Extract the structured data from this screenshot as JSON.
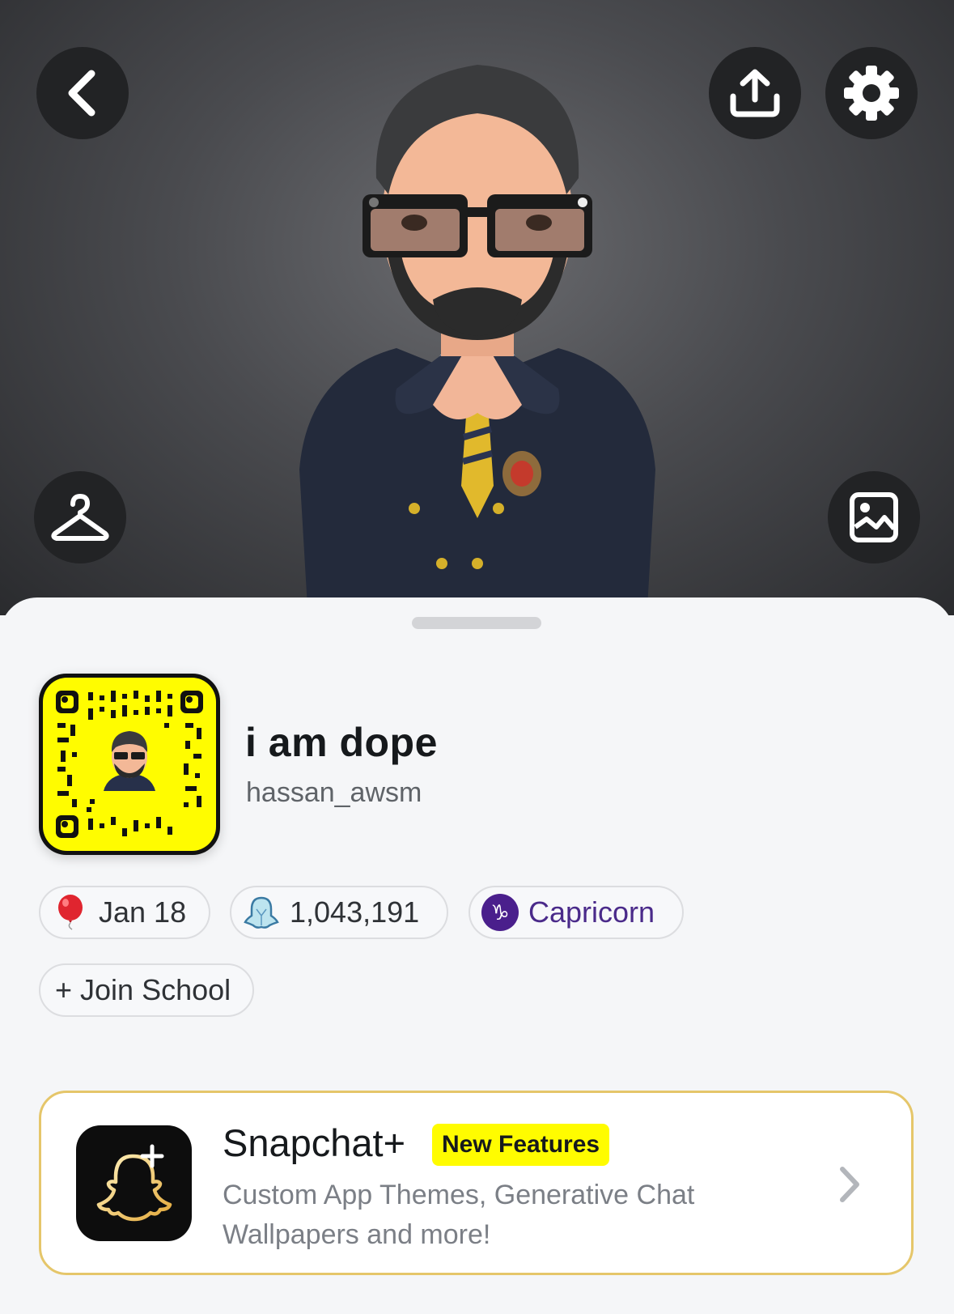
{
  "header": {
    "back_icon": "chevron-left-icon",
    "share_icon": "share-upload-icon",
    "settings_icon": "gear-icon",
    "outfit_icon": "hanger-icon",
    "photo_icon": "image-icon"
  },
  "profile": {
    "display_name": "i am dope",
    "username": "hassan_awsm"
  },
  "chips": {
    "birthday": "Jan 18",
    "score": "1,043,191",
    "zodiac": "Capricorn",
    "zodiac_symbol": "♑",
    "school": "+ Join School"
  },
  "snapchat_plus": {
    "title": "Snapchat+",
    "badge": "New Features",
    "description": "Custom App Themes, Generative Chat Wallpapers and more!"
  },
  "colors": {
    "snap_yellow": "#fffc00",
    "zodiac_purple": "#4a2a8a",
    "plus_border": "#e5c66a"
  }
}
